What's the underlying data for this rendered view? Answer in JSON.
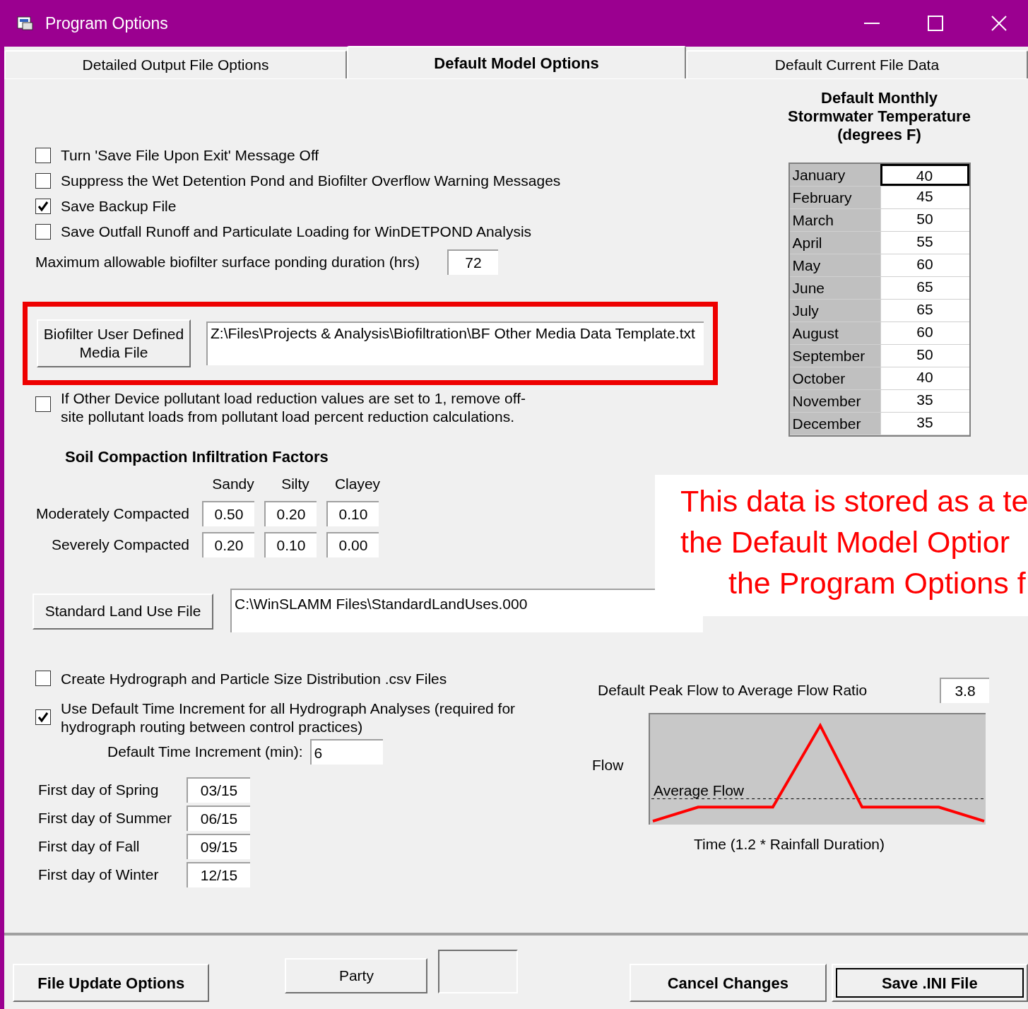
{
  "window": {
    "title": "Program Options"
  },
  "tabs": [
    {
      "label": "Detailed Output File Options",
      "selected": false
    },
    {
      "label": "Default Model Options",
      "selected": true
    },
    {
      "label": "Default Current File Data",
      "selected": false
    }
  ],
  "options": [
    {
      "label": "Turn 'Save File Upon Exit' Message Off",
      "checked": false
    },
    {
      "label": "Suppress the Wet Detention Pond and Biofilter Overflow Warning Messages",
      "checked": false
    },
    {
      "label": "Save Backup File",
      "checked": true
    },
    {
      "label": "Save Outfall Runoff and Particulate Loading for WinDETPOND Analysis",
      "checked": false
    }
  ],
  "ponding": {
    "label": "Maximum allowable biofilter surface ponding duration (hrs)",
    "value": "72"
  },
  "biofilter": {
    "button": "Biofilter User Defined Media File",
    "path": "Z:\\Files\\Projects & Analysis\\Biofiltration\\BF Other Media Data Template.txt"
  },
  "offsite": {
    "label": "If Other Device pollutant load reduction values are set to 1, remove off-site pollutant loads from pollutant load percent reduction calculations.",
    "checked": false
  },
  "soil": {
    "title": "Soil Compaction Infiltration Factors",
    "columns": [
      "Sandy",
      "Silty",
      "Clayey"
    ],
    "rows": [
      {
        "label": "Moderately Compacted",
        "values": [
          "0.50",
          "0.20",
          "0.10"
        ]
      },
      {
        "label": "Severely Compacted",
        "values": [
          "0.20",
          "0.10",
          "0.00"
        ]
      }
    ]
  },
  "land_use": {
    "button": "Standard Land Use File",
    "path": "C:\\WinSLAMM Files\\StandardLandUses.000"
  },
  "temperature": {
    "title": "Default Monthly Stormwater Temperature (degrees F)",
    "months": [
      {
        "month": "January",
        "value": "40",
        "selected": true
      },
      {
        "month": "February",
        "value": "45",
        "selected": false
      },
      {
        "month": "March",
        "value": "50",
        "selected": false
      },
      {
        "month": "April",
        "value": "55",
        "selected": false
      },
      {
        "month": "May",
        "value": "60",
        "selected": false
      },
      {
        "month": "June",
        "value": "65",
        "selected": false
      },
      {
        "month": "July",
        "value": "65",
        "selected": false
      },
      {
        "month": "August",
        "value": "60",
        "selected": false
      },
      {
        "month": "September",
        "value": "50",
        "selected": false
      },
      {
        "month": "October",
        "value": "40",
        "selected": false
      },
      {
        "month": "November",
        "value": "35",
        "selected": false
      },
      {
        "month": "December",
        "value": "35",
        "selected": false
      }
    ]
  },
  "annotation": {
    "lines": [
      "This data is stored as a te",
      "the Default Model Optior",
      "the Program Options f"
    ]
  },
  "csv": {
    "label": "Create Hydrograph and Particle Size Distribution .csv Files",
    "checked": false
  },
  "time_increment": {
    "label": "Use Default Time Increment for all Hydrograph Analyses (required for hydrograph routing between control practices)",
    "checked": true,
    "field_label": "Default Time Increment (min):",
    "value": "6"
  },
  "seasons": [
    {
      "label": "First day of Spring",
      "value": "03/15"
    },
    {
      "label": "First day of Summer",
      "value": "06/15"
    },
    {
      "label": "First day of Fall",
      "value": "09/15"
    },
    {
      "label": "First day of Winter",
      "value": "12/15"
    }
  ],
  "peak": {
    "label": "Default Peak Flow to Average Flow Ratio",
    "value": "3.8",
    "y_label": "Flow",
    "x_label": "Time (1.2 * Rainfall Duration)",
    "line_label": "Average Flow"
  },
  "buttons": [
    {
      "label": "File Update Options",
      "bold": true,
      "default": false
    },
    {
      "label": "Party",
      "bold": false,
      "default": false
    },
    {
      "label": "Cancel Changes",
      "bold": true,
      "default": false
    },
    {
      "label": "Save .INI File",
      "bold": true,
      "default": true
    }
  ]
}
